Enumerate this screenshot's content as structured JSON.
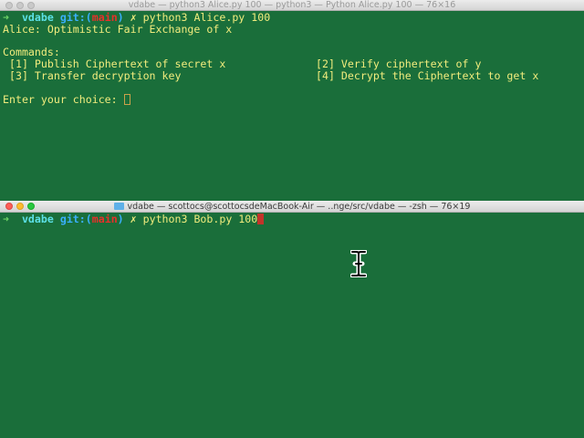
{
  "top_window": {
    "title": "vdabe — python3 Alice.py 100 — python3 — Python Alice.py 100 — 76×16",
    "prompt": {
      "arrow": "➜",
      "dir": "vdabe",
      "git_label": "git:",
      "paren_open": "(",
      "branch": "main",
      "paren_close": ")",
      "dirty_mark": "✗",
      "command": "python3 Alice.py 100"
    },
    "header": "Alice: Optimistic Fair Exchange of x",
    "commands_label": "Commands:",
    "commands": [
      "[1] Publish Ciphertext of secret x",
      "[2] Verify ciphertext of y",
      "[3] Transfer decryption key",
      "[4] Decrypt the Ciphertext to get x"
    ],
    "input_prompt": "Enter your choice: "
  },
  "bottom_window": {
    "title": "vdabe — scottocs@scottocsdeMacBook-Air — ..nge/src/vdabe — -zsh — 76×19",
    "prompt": {
      "arrow": "➜",
      "dir": "vdabe",
      "git_label": "git:",
      "paren_open": "(",
      "branch": "main",
      "paren_close": ")",
      "dirty_mark": "✗",
      "command": "python3 Bob.py 100"
    }
  },
  "colors": {
    "terminal_bg": "#1a6e3a",
    "text": "#f1ec7d",
    "arrow": "#6fd467",
    "dir": "#5ce0e6",
    "git": "#3ab0ff",
    "branch": "#e8302a",
    "cursor": "#c2342a"
  },
  "icons": {
    "top_lights": [
      "close-light-inactive",
      "minimize-light-inactive",
      "zoom-light-inactive"
    ],
    "bottom_lights": [
      "close-light",
      "minimize-light",
      "zoom-light"
    ],
    "title_icon": "folder-icon",
    "mouse_cursor": "ibeam-cursor-icon"
  }
}
